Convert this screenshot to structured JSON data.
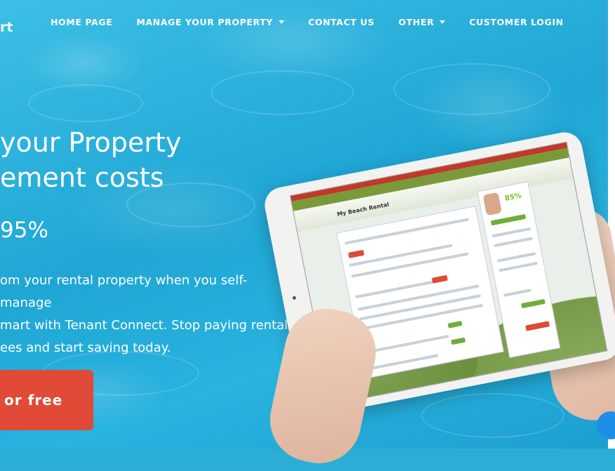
{
  "brand": {
    "logo_text": "rt"
  },
  "nav": {
    "items": [
      {
        "label": "HOME PAGE",
        "dropdown": false
      },
      {
        "label": "MANAGE YOUR PROPERTY",
        "dropdown": true
      },
      {
        "label": "CONTACT US",
        "dropdown": false
      },
      {
        "label": "OTHER",
        "dropdown": true
      },
      {
        "label": "CUSTOMER LOGIN",
        "dropdown": false
      }
    ]
  },
  "hero": {
    "headline_line1": "your Property",
    "headline_line2": "ement costs",
    "percent": "95%",
    "body_line1": "om your rental property when you self-manage",
    "body_line2": "mart with Tenant Connect. Stop paying rental",
    "body_line3": "ees and start saving today.",
    "cta_label": "or free"
  },
  "tablet_screen": {
    "title": "My Beach Rental",
    "pct": "85%"
  },
  "colors": {
    "pool": "#2aaed6",
    "cta": "#e04a36",
    "chat": "#1e8fe8"
  }
}
